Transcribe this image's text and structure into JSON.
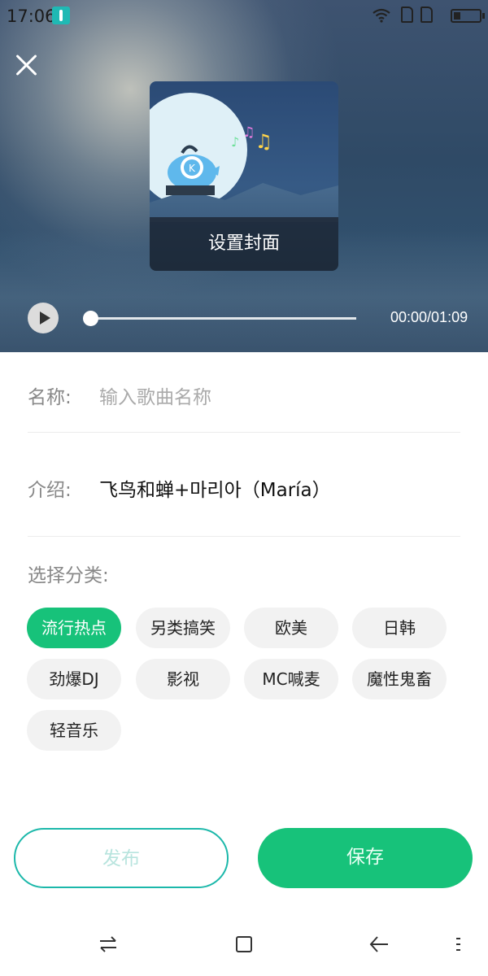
{
  "status_bar": {
    "time": "17:06"
  },
  "cover": {
    "overlay_label": "设置封面"
  },
  "player": {
    "time_display": "00:00/01:09",
    "progress": 0
  },
  "form": {
    "name_label": "名称:",
    "name_placeholder": "输入歌曲名称",
    "intro_label": "介绍:",
    "intro_value": "飞鸟和蝉+마리아（María）",
    "category_label": "选择分类:"
  },
  "categories": [
    {
      "label": "流行热点",
      "selected": true
    },
    {
      "label": "另类搞笑",
      "selected": false
    },
    {
      "label": "欧美",
      "selected": false
    },
    {
      "label": "日韩",
      "selected": false
    },
    {
      "label": "劲爆DJ",
      "selected": false
    },
    {
      "label": "影视",
      "selected": false
    },
    {
      "label": "MC喊麦",
      "selected": false
    },
    {
      "label": "魔性鬼畜",
      "selected": false
    },
    {
      "label": "轻音乐",
      "selected": false
    }
  ],
  "actions": {
    "publish_label": "发布",
    "save_label": "保存"
  },
  "colors": {
    "accent": "#17c27a",
    "publish_border": "#1cb8aa"
  },
  "icons": {
    "close": "close-icon",
    "play": "play-icon",
    "nav": [
      "switch-icon",
      "home-square-icon",
      "back-icon",
      "menu-icon"
    ]
  }
}
